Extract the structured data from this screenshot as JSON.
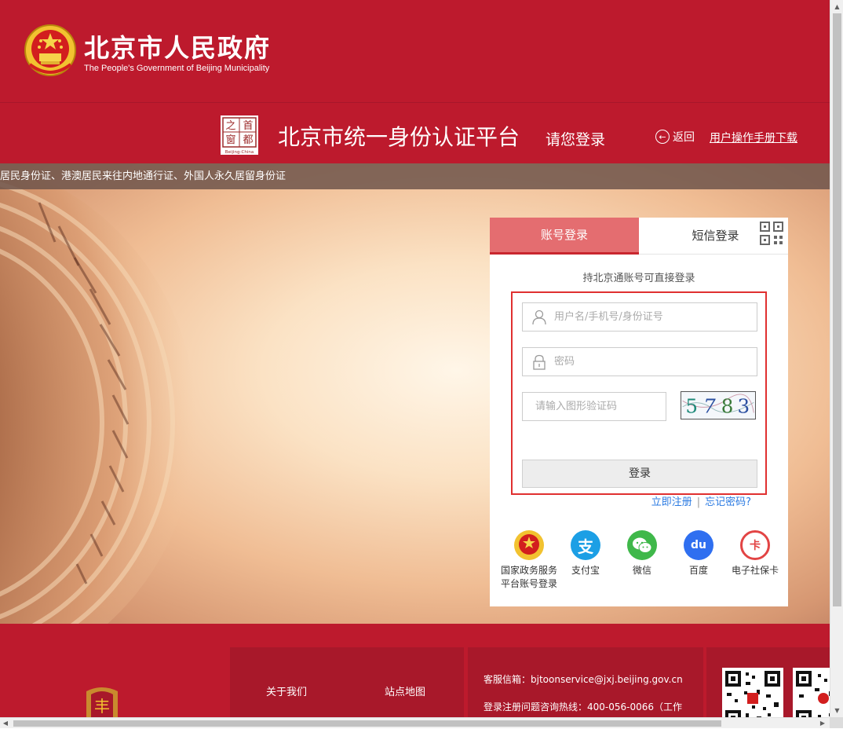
{
  "header": {
    "gov_name": "北京市人民政府",
    "gov_sub": "The People's Government of Beijing Municipality"
  },
  "platform": {
    "logo_chars": [
      "之",
      "首",
      "窗",
      "都"
    ],
    "logo_caption": "Beijing-China",
    "title": "北京市统一身份认证平台",
    "subtitle": "请您登录",
    "back_label": "返回",
    "manual_label": "用户操作手册下载"
  },
  "ticker": {
    "text": "居民身份证、港澳居民来往内地通行证、外国人永久居留身份证"
  },
  "login": {
    "tab_account": "账号登录",
    "tab_sms": "短信登录",
    "hint": "持北京通账号可直接登录",
    "username_placeholder": "用户名/手机号/身份证号",
    "password_placeholder": "密码",
    "captcha_placeholder": "请输入图形验证码",
    "captcha_code": [
      "5",
      "7",
      "8",
      "3"
    ],
    "login_button": "登录",
    "register_link": "立即注册",
    "separator": "|",
    "forgot_link": "忘记密码?",
    "third_party": [
      {
        "line1": "国家政务服务",
        "line2": "平台账号登录",
        "color": "#c8302c",
        "icon": "national-emblem-icon",
        "glyph": "★"
      },
      {
        "line1": "支付宝",
        "line2": "",
        "color": "#1c9fe5",
        "icon": "alipay-icon",
        "glyph": "支"
      },
      {
        "line1": "微信",
        "line2": "",
        "color": "#3fb84a",
        "icon": "wechat-icon",
        "glyph": ""
      },
      {
        "line1": "百度",
        "line2": "",
        "color": "#2f6ff0",
        "icon": "baidu-icon",
        "glyph": "du"
      },
      {
        "line1": "电子社保卡",
        "line2": "",
        "color": "#e24444",
        "icon": "social-security-card-icon",
        "glyph": "卡"
      }
    ]
  },
  "footer": {
    "about": "关于我们",
    "sitemap": "站点地图",
    "email_line": "客服信箱：bjtoonservice@jxj.beijing.gov.cn",
    "hotline_line": "登录注册问题咨询热线：400-056-0066（工作"
  },
  "colors": {
    "brand_red": "#bd1a2d",
    "tab_active": "#e46d70",
    "highlight_border": "#e03030",
    "link_blue": "#2a7ae2"
  }
}
